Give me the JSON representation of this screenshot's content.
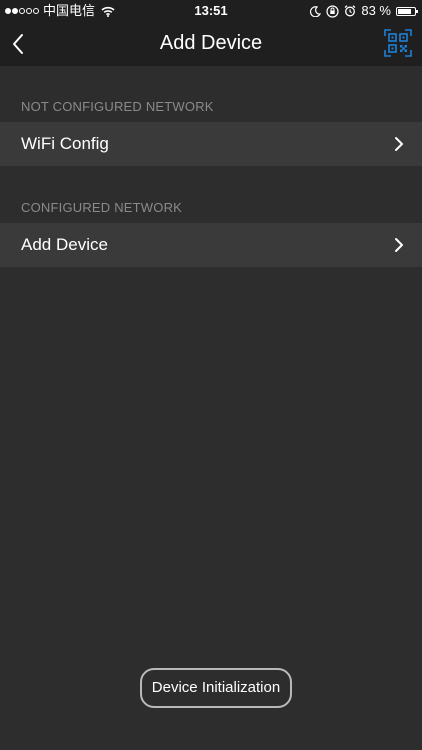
{
  "status_bar": {
    "carrier": "中国电信",
    "time": "13:51",
    "battery_percent": "83 %",
    "battery_level": 0.83,
    "signal_filled": 2,
    "signal_total": 5
  },
  "nav": {
    "title": "Add Device",
    "back_icon": "chevron-left-icon",
    "qr_icon": "qr-scan-icon",
    "accent_color": "#1e7fd6"
  },
  "sections": [
    {
      "header": "NOT CONFIGURED NETWORK",
      "items": [
        {
          "label": "WiFi Config"
        }
      ]
    },
    {
      "header": "CONFIGURED NETWORK",
      "items": [
        {
          "label": "Add Device"
        }
      ]
    }
  ],
  "footer": {
    "button_label": "Device Initialization"
  }
}
